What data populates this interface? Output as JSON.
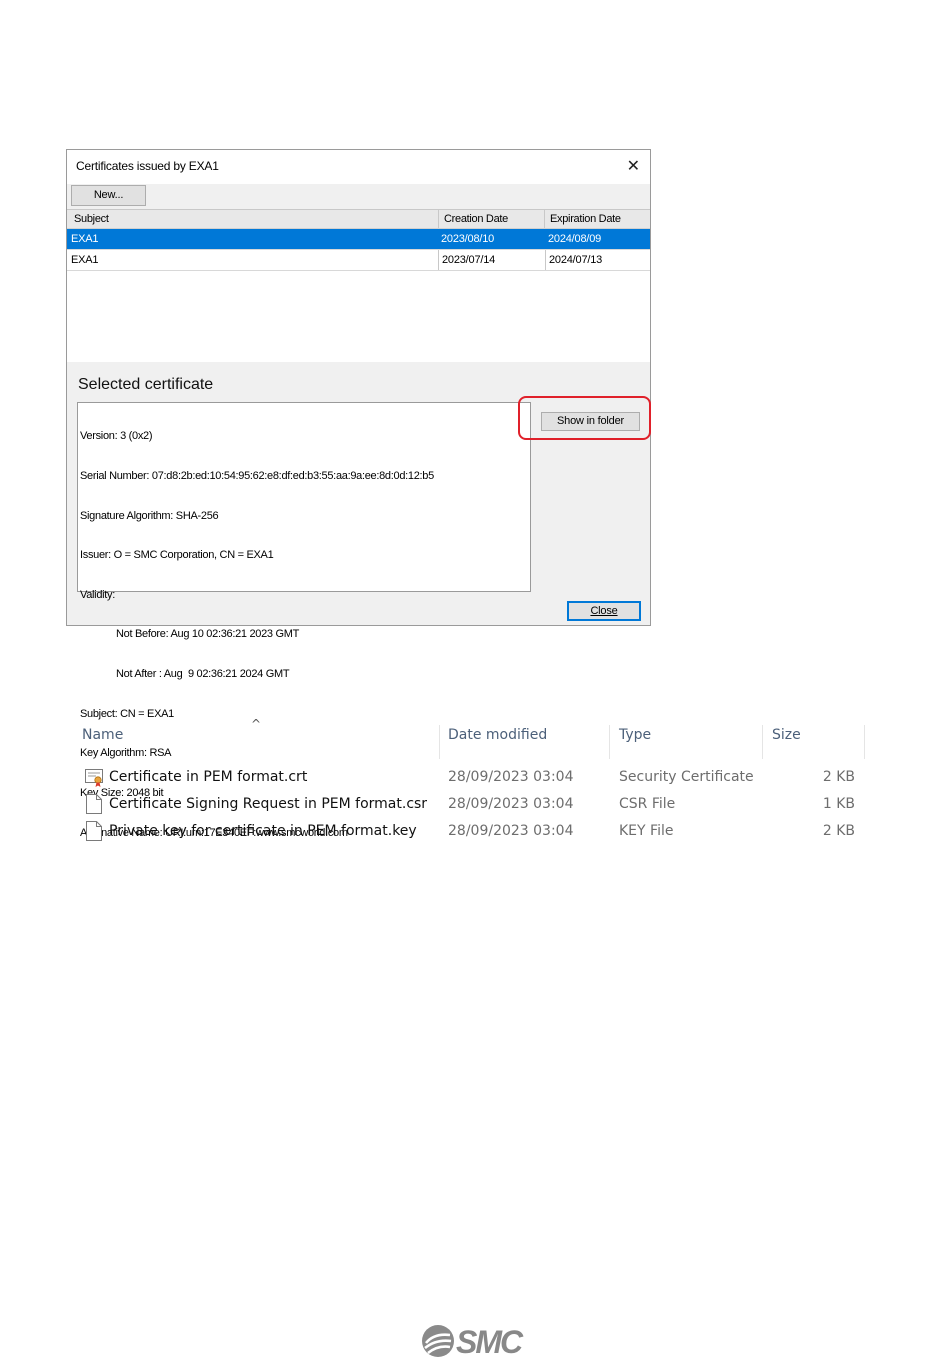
{
  "dialog": {
    "title": "Certificates issued by EXA1",
    "close_glyph": "✕",
    "new_button": "New...",
    "columns": [
      "Subject",
      "Creation Date",
      "Expiration Date"
    ],
    "rows": [
      {
        "subject": "EXA1",
        "created": "2023/08/10",
        "expires": "2024/08/09",
        "selected": true
      },
      {
        "subject": "EXA1",
        "created": "2023/07/14",
        "expires": "2024/07/13",
        "selected": false
      }
    ],
    "selected_title": "Selected certificate",
    "details": [
      "Version: 3 (0x2)",
      "Serial Number: 07:d8:2b:ed:10:54:95:62:e8:df:ed:b3:55:aa:9a:ee:8d:0d:12:b5",
      "Signature Algorithm: SHA-256",
      "Issuer: O = SMC Corporation, CN = EXA1",
      "Validity:",
      "Not Before: Aug 10 02:36:21 2023 GMT",
      "Not After : Aug  9 02:36:21 2024 GMT",
      "Subject: CN = EXA1",
      "Key Algorithm: RSA",
      "Key Size: 2048 bit",
      "Alternative Name: URI:urn:17E340EF:www.smcworld.com"
    ],
    "show_in_folder": "Show in folder",
    "close_button": "Close",
    "highlight_color": "#e0202a",
    "selection_color": "#0078d7"
  },
  "explorer": {
    "sort_indicator": "^",
    "columns": [
      "Name",
      "Date modified",
      "Type",
      "Size"
    ],
    "files": [
      {
        "name": "Certificate in PEM format.crt",
        "modified": "28/09/2023 03:04",
        "type": "Security Certificate",
        "size": "2 KB",
        "icon": "certificate-file-icon"
      },
      {
        "name": "Certificate Signing Request in PEM format.csr",
        "modified": "28/09/2023 03:04",
        "type": "CSR File",
        "size": "1 KB",
        "icon": "generic-file-icon"
      },
      {
        "name": "Private key for certificate in PEM format.key",
        "modified": "28/09/2023 03:04",
        "type": "KEY File",
        "size": "2 KB",
        "icon": "generic-file-icon"
      }
    ]
  },
  "footer": {
    "logo_text": "SMC",
    "logo_icon": "smc-logo-icon"
  }
}
